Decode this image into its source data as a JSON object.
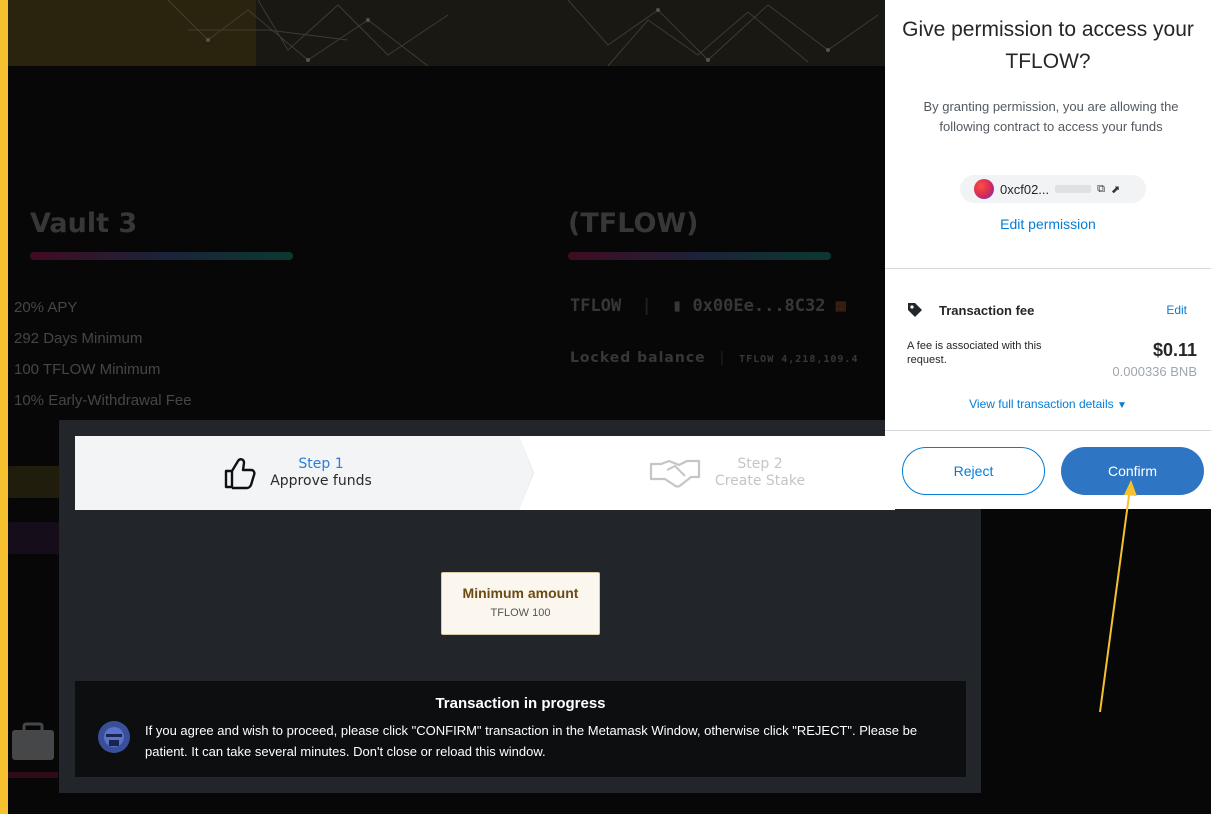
{
  "background_page": {
    "vault_title": "Vault 3",
    "token_title": "(TFLOW)",
    "vault_info": [
      "20% APY",
      "292 Days Minimum",
      "100 TFLOW Minimum",
      "10% Early-Withdrawal Fee"
    ],
    "token_symbol": "TFLOW",
    "token_address": "0x00Ee...8C32",
    "locked_label": "Locked balance",
    "locked_value": "TFLOW 4,218,109.4"
  },
  "modal": {
    "step1": {
      "number": "Step 1",
      "label": "Approve funds"
    },
    "step2": {
      "number": "Step 2",
      "label": "Create Stake"
    },
    "minimum": {
      "title": "Minimum amount",
      "value": "TFLOW 100"
    },
    "progress": {
      "title": "Transaction in progress",
      "text": "If you agree and wish to proceed, please click \"CONFIRM\" transaction in the Metamask Window, otherwise click \"REJECT\". Please be patient. It can take several minutes. Don't close or reload this window."
    }
  },
  "metamask": {
    "title": "Give permission to access your TFLOW?",
    "subtitle": "By granting permission, you are allowing the following contract to access your funds",
    "address": "0xcf02...",
    "edit_permission": "Edit permission",
    "fee_label": "Transaction fee",
    "fee_edit": "Edit",
    "fee_desc": "A fee is associated with this request.",
    "fee_usd": "$0.11",
    "fee_bnb": "0.000336 BNB",
    "view_details": "View full transaction details",
    "reject_label": "Reject",
    "confirm_label": "Confirm"
  },
  "colors": {
    "frame": "#f5c12e",
    "metamask_blue": "#037dd6",
    "confirm_button": "#2e75c4",
    "annotation_arrow": "#f5c12e"
  },
  "icons": {
    "step1": "thumbs-up-icon",
    "step2": "handshake-icon",
    "fee": "tag-icon",
    "copy": "copy-icon",
    "external": "external-link-icon"
  }
}
